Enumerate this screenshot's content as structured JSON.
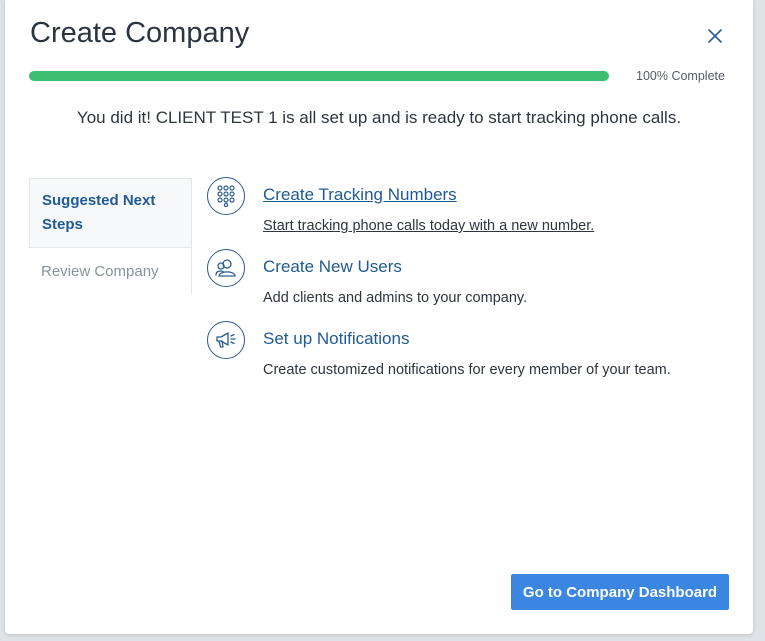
{
  "modal": {
    "title": "Create Company",
    "close_icon": "close-icon"
  },
  "progress": {
    "fraction": 1.0,
    "label": "100% Complete",
    "fill_color": "#3dbd6e"
  },
  "message": "You did it! CLIENT TEST 1 is all set up and is ready to start tracking phone calls.",
  "side_tabs": [
    {
      "label": "Suggested Next Steps",
      "active": true
    },
    {
      "label": "Review Company",
      "active": false
    }
  ],
  "steps": [
    {
      "icon": "keypad-icon",
      "title": "Create Tracking Numbers",
      "description": "Start tracking phone calls today with a new number."
    },
    {
      "icon": "users-icon",
      "title": "Create New Users",
      "description": "Add clients and admins to your company."
    },
    {
      "icon": "megaphone-icon",
      "title": "Set up Notifications",
      "description": "Create customized notifications for every member of your team."
    }
  ],
  "primary_button": {
    "label": "Go to Company Dashboard",
    "color": "#3a86e0"
  },
  "colors": {
    "accent": "#1f5a96",
    "text": "#2e3540"
  }
}
